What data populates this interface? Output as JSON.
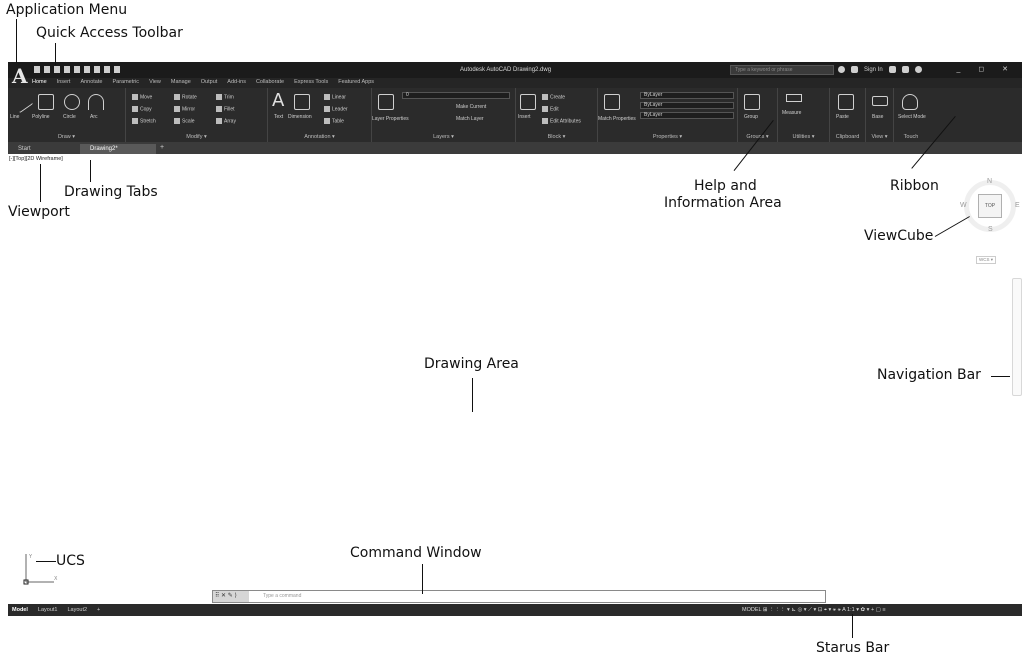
{
  "callouts": {
    "application_menu": "Application Menu",
    "quick_access_toolbar": "Quick Access Toolbar",
    "drawing_tabs": "Drawing Tabs",
    "viewport": "Viewport",
    "help_info_line1": "Help and",
    "help_info_line2": "Information Area",
    "ribbon": "Ribbon",
    "viewcube": "ViewCube",
    "drawing_area": "Drawing Area",
    "navigation_bar": "Navigation Bar",
    "ucs": "UCS",
    "command_window": "Command Window",
    "status_bar": "Starus Bar"
  },
  "app": {
    "logo": "A",
    "title": "Autodesk AutoCAD  Drawing2.dwg",
    "search_placeholder": "Type a keyword or phrase",
    "user": "Sign In",
    "window_controls": "_ ◻ ✕"
  },
  "ribbon_tabs": [
    "Home",
    "Insert",
    "Annotate",
    "Parametric",
    "View",
    "Manage",
    "Output",
    "Add-ins",
    "Collaborate",
    "Express Tools",
    "Featured Apps"
  ],
  "panels": {
    "draw": "Draw ▾",
    "modify": "Modify ▾",
    "annotation": "Annotation ▾",
    "layers": "Layers ▾",
    "block": "Block ▾",
    "properties": "Properties ▾",
    "groups": "Groups ▾",
    "utilities": "Utilities ▾",
    "clipboard": "Clipboard",
    "view": "View ▾",
    "touch": "Touch"
  },
  "tools": {
    "line": "Line",
    "polyline": "Polyline",
    "circle": "Circle",
    "arc": "Arc",
    "move": "Move",
    "copy": "Copy",
    "stretch": "Stretch",
    "rotate": "Rotate",
    "mirror": "Mirror",
    "scale": "Scale",
    "trim": "Trim",
    "fillet": "Fillet",
    "array": "Array",
    "text": "Text",
    "dimension": "Dimension",
    "linear": "Linear",
    "leader": "Leader",
    "table": "Table",
    "layer_properties": "Layer Properties",
    "make_current": "Make Current",
    "match_layer": "Match Layer",
    "insert": "Insert",
    "create": "Create",
    "edit": "Edit",
    "edit_attributes": "Edit Attributes",
    "match_properties": "Match Properties",
    "bylayer": "ByLayer",
    "group": "Group",
    "measure": "Measure",
    "paste": "Paste",
    "base": "Base",
    "select_mode": "Select Mode"
  },
  "doc_tabs": {
    "start": "Start",
    "drawing": "Drawing2*"
  },
  "viewport_label": "[-][Top][2D Wireframe]",
  "viewcube": {
    "top": "TOP",
    "n": "N",
    "w": "W",
    "e": "E",
    "s": "S",
    "wcs": "WCS ▾"
  },
  "command": {
    "placeholder": "Type a command"
  },
  "layout_tabs": [
    "Model",
    "Layout1",
    "Layout2",
    "+"
  ],
  "status_right": "MODEL  ⊞ ⋮⋮⋮ ▾  ⊾ ◎ ▾ ⟋ ▾ ⊡ ⌖ ▾  ⚹ ⚹ A 1:1 ▾ ✿ ▾ + ▢ ≡"
}
